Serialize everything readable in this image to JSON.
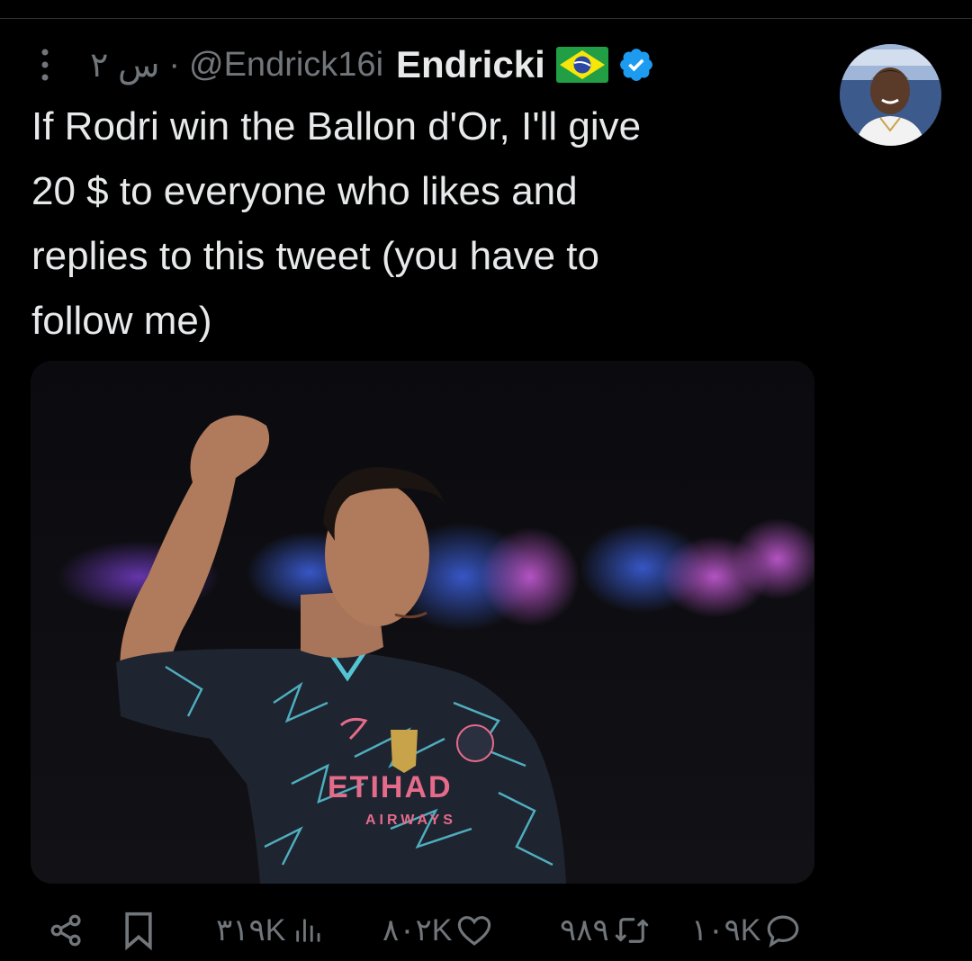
{
  "tweet": {
    "author_name": "Endricki",
    "handle": "@Endrick16i",
    "time": "۲ س",
    "separator": "·",
    "text": "If Rodri win the Ballon d'Or, I'll give\n20 $ to everyone who likes and\nreplies to this tweet (you have to\nfollow me)",
    "media_alt": "Rodri raising fist in Manchester City third kit",
    "kit_sponsor_top": "ETIHAD",
    "kit_sponsor_bottom": "AIRWAYS"
  },
  "actions": {
    "views": "۳۱۹K",
    "likes": "۸۰۲K",
    "retweets": "۹۸۹",
    "replies": "۱۰۹K"
  },
  "icons": {
    "more": "more-vertical-icon",
    "flag": "brazil-flag-icon",
    "verified": "verified-badge-icon",
    "share": "share-icon",
    "bookmark": "bookmark-icon",
    "views": "analytics-icon",
    "like": "heart-icon",
    "retweet": "retweet-icon",
    "reply": "reply-icon"
  },
  "colors": {
    "background": "#000000",
    "text": "#e7e9ea",
    "muted": "#71767b",
    "verified": "#1d9bf0"
  }
}
